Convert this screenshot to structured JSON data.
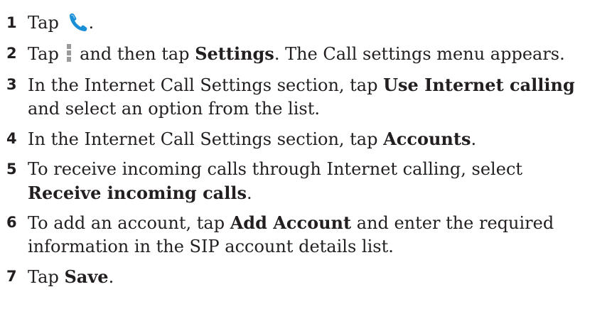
{
  "steps": [
    {
      "number": "1",
      "parts": {
        "a": "Tap ",
        "b": "."
      },
      "icon": "phone-call-icon"
    },
    {
      "number": "2",
      "parts": {
        "a": "Tap ",
        "b": " and then tap ",
        "c": "Settings",
        "d": ". The Call settings menu appears."
      },
      "icon": "menu-icon"
    },
    {
      "number": "3",
      "parts": {
        "a": "In the Internet Call Settings section, tap ",
        "b": "Use Internet calling",
        "c": " and select an option from the list."
      }
    },
    {
      "number": "4",
      "parts": {
        "a": "In the Internet Call Settings section, tap ",
        "b": "Accounts",
        "c": "."
      }
    },
    {
      "number": "5",
      "parts": {
        "a": "To receive incoming calls through Internet calling, select ",
        "b": "Receive incoming calls",
        "c": "."
      }
    },
    {
      "number": "6",
      "parts": {
        "a": "To add an account, tap ",
        "b": "Add Account",
        "c": " and enter the required information in the SIP account details list."
      }
    },
    {
      "number": "7",
      "parts": {
        "a": "Tap ",
        "b": "Save",
        "c": "."
      }
    }
  ],
  "colors": {
    "text": "#231f20",
    "phone_icon": "#1a8fd6",
    "menu_icon": "#9a9a9a"
  }
}
